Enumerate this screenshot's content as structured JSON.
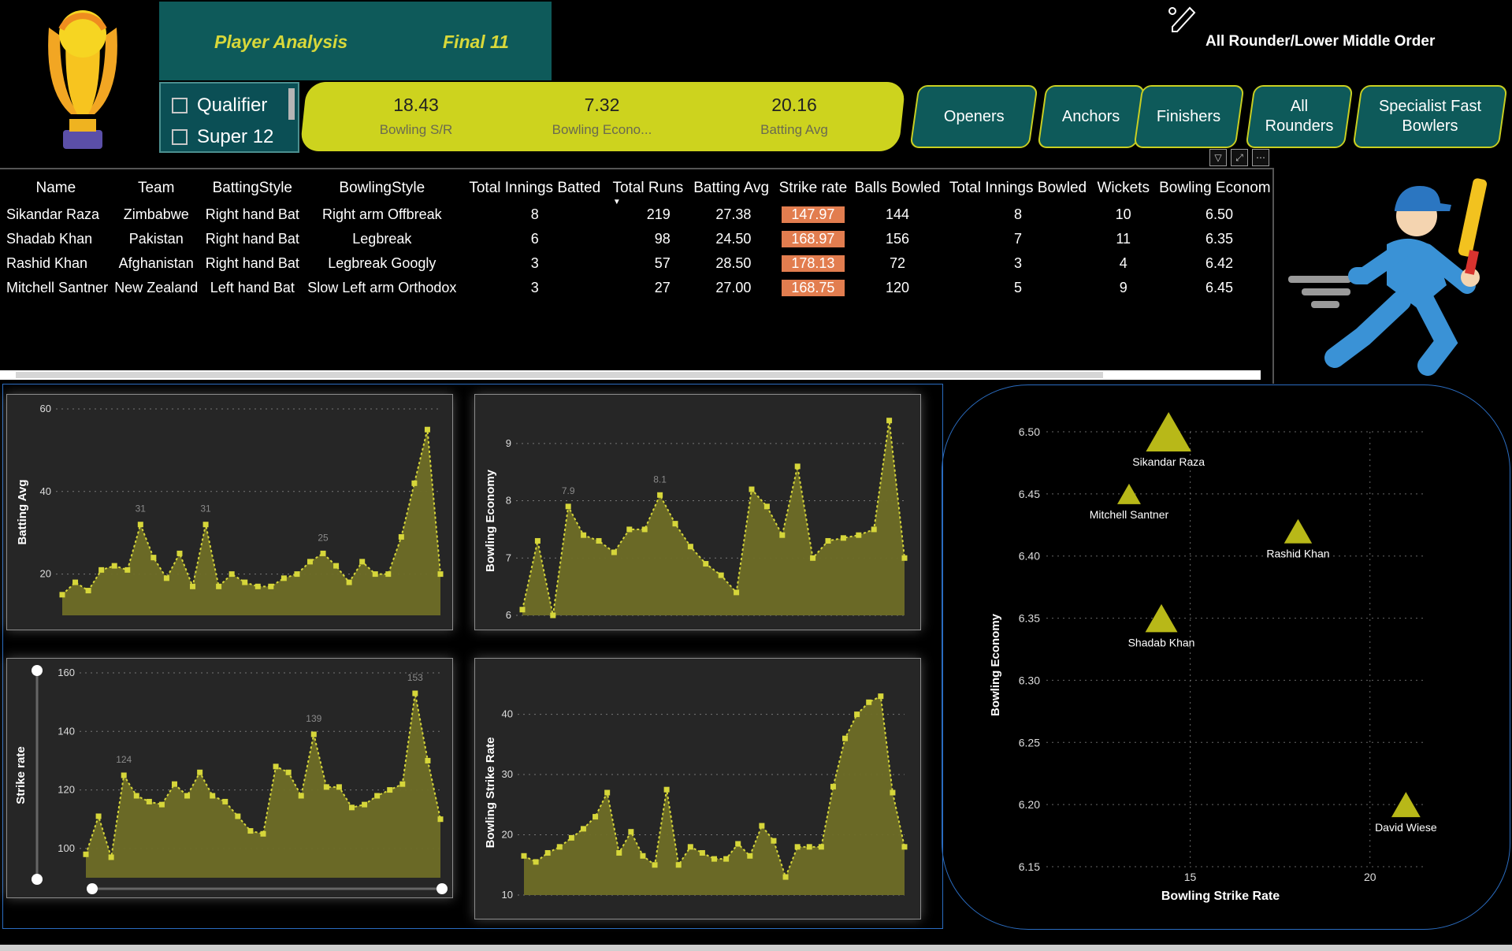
{
  "header": {
    "title": "Player Analysis",
    "subtitle": "Final 11",
    "role_title": "All Rounder/Lower Middle Order"
  },
  "slicer": {
    "items": [
      "Qualifier",
      "Super 12"
    ]
  },
  "kpis": [
    {
      "value": "18.43",
      "label": "Bowling S/R"
    },
    {
      "value": "7.32",
      "label": "Bowling Econo..."
    },
    {
      "value": "20.16",
      "label": "Batting Avg"
    }
  ],
  "categories": [
    {
      "label": "Openers"
    },
    {
      "label": "Anchors"
    },
    {
      "label": "Finishers"
    },
    {
      "label": "All Rounders"
    },
    {
      "label": "Specialist Fast Bowlers"
    }
  ],
  "table": {
    "columns": [
      "Name",
      "Team",
      "BattingStyle",
      "BowlingStyle",
      "Total Innings Batted",
      "Total Runs",
      "Batting Avg",
      "Strike rate",
      "Balls Bowled",
      "Total Innings Bowled",
      "Wickets",
      "Bowling Econom"
    ],
    "rows": [
      [
        "Sikandar Raza",
        "Zimbabwe",
        "Right hand Bat",
        "Right arm Offbreak",
        "8",
        "219",
        "27.38",
        "147.97",
        "144",
        "8",
        "10",
        "6.50"
      ],
      [
        "Shadab Khan",
        "Pakistan",
        "Right hand Bat",
        "Legbreak",
        "6",
        "98",
        "24.50",
        "168.97",
        "156",
        "7",
        "11",
        "6.35"
      ],
      [
        "Rashid Khan",
        "Afghanistan",
        "Right hand Bat",
        "Legbreak Googly",
        "3",
        "57",
        "28.50",
        "178.13",
        "72",
        "3",
        "4",
        "6.42"
      ],
      [
        "Mitchell Santner",
        "New Zealand",
        "Left hand Bat",
        "Slow Left arm Orthodox",
        "3",
        "27",
        "27.00",
        "168.75",
        "120",
        "5",
        "9",
        "6.45"
      ]
    ]
  },
  "colors": {
    "teal": "#0e5a5a",
    "kpi_yellow": "#cdd31e",
    "area_fill": "#6e6d26",
    "line_yellow": "#d6d63a",
    "strike_rate_highlight": "#e27d4f",
    "panel_bg": "#262626"
  },
  "chart_data": [
    {
      "type": "area",
      "ylabel": "Batting Avg",
      "ylim": [
        10,
        60
      ],
      "y_ticks": [
        20,
        40,
        60
      ],
      "values": [
        15,
        18,
        16,
        21,
        22,
        21,
        32,
        24,
        19,
        25,
        17,
        32,
        17,
        20,
        18,
        17,
        17,
        19,
        20,
        23,
        25,
        22,
        18,
        23,
        20,
        20,
        29,
        42,
        55,
        20
      ],
      "data_labels": [
        {
          "index": 6,
          "text": "31"
        },
        {
          "index": 11,
          "text": "31"
        },
        {
          "index": 20,
          "text": "25"
        }
      ]
    },
    {
      "type": "area",
      "ylabel": "Bowling Economy",
      "ylim": [
        6,
        9.3
      ],
      "y_ticks": [
        6,
        7,
        8,
        9
      ],
      "values": [
        6.1,
        7.3,
        6.0,
        7.9,
        7.4,
        7.3,
        7.1,
        7.5,
        7.5,
        8.1,
        7.6,
        7.2,
        6.9,
        6.7,
        6.4,
        8.2,
        7.9,
        7.4,
        8.6,
        7.0,
        7.3,
        7.35,
        7.4,
        7.5,
        9.4,
        7.0
      ],
      "data_labels": [
        {
          "index": 3,
          "text": "7.9"
        },
        {
          "index": 9,
          "text": "8.1"
        }
      ]
    },
    {
      "type": "area",
      "ylabel": "Strike rate",
      "ylim": [
        90,
        160
      ],
      "y_ticks": [
        100,
        120,
        140,
        160
      ],
      "values": [
        98,
        111,
        97,
        125,
        118,
        116,
        115,
        122,
        118,
        126,
        118,
        116,
        111,
        106,
        105,
        128,
        126,
        118,
        139,
        121,
        121,
        114,
        115,
        118,
        120,
        122,
        153,
        130,
        110
      ],
      "data_labels": [
        {
          "index": 3,
          "text": "124"
        },
        {
          "index": 18,
          "text": "139"
        },
        {
          "index": 26,
          "text": "153"
        }
      ]
    },
    {
      "type": "area",
      "ylabel": "Bowling Strike Rate",
      "ylim": [
        10,
        44
      ],
      "y_ticks": [
        10,
        20,
        30,
        40
      ],
      "values": [
        16.5,
        15.5,
        17,
        18,
        19.5,
        21,
        23,
        27,
        17,
        20.5,
        16.5,
        15,
        27.5,
        15,
        18,
        17,
        16,
        16,
        18.5,
        16.5,
        21.5,
        19,
        13,
        18,
        18,
        18,
        28,
        36,
        40,
        42,
        43,
        27,
        18
      ]
    },
    {
      "type": "scatter",
      "xlabel": "Bowling Strike Rate",
      "ylabel": "Bowling Economy",
      "xlim": [
        11,
        22
      ],
      "ylim": [
        6.15,
        6.5
      ],
      "x_ticks": [
        15,
        20
      ],
      "y_ticks": [
        "6.15",
        "6.20",
        "6.25",
        "6.30",
        "6.35",
        "6.40",
        "6.45",
        "6.50"
      ],
      "points": [
        {
          "name": "Sikandar Raza",
          "x": 14.4,
          "y": 6.5,
          "size": 3
        },
        {
          "name": "Mitchell Santner",
          "x": 13.3,
          "y": 6.45,
          "size": 1
        },
        {
          "name": "Rashid Khan",
          "x": 18.0,
          "y": 6.42,
          "size": 1.4
        },
        {
          "name": "Shadab Khan",
          "x": 14.2,
          "y": 6.35,
          "size": 1.8
        },
        {
          "name": "David Wiese",
          "x": 21.0,
          "y": 6.2,
          "size": 1.5
        }
      ]
    }
  ]
}
